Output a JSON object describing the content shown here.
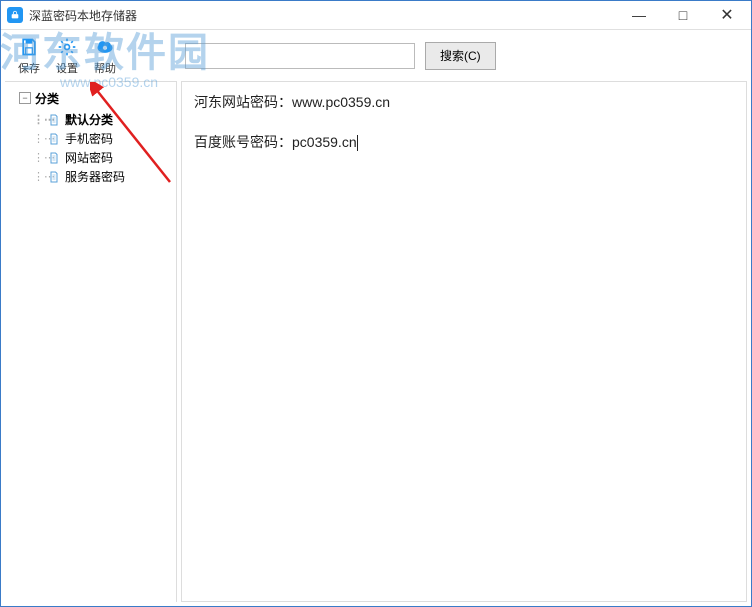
{
  "title": "深蓝密码本地存储器",
  "window": {
    "min": "—",
    "max": "□",
    "close": "✕"
  },
  "toolbar": {
    "save": "保存",
    "settings": "设置",
    "help": "帮助"
  },
  "search": {
    "placeholder": "",
    "button": "搜索(C)"
  },
  "tree": {
    "root": "分类",
    "items": [
      {
        "label": "默认分类"
      },
      {
        "label": "手机密码"
      },
      {
        "label": "网站密码"
      },
      {
        "label": "服务器密码"
      }
    ]
  },
  "content": {
    "line1": "河东网站密码：www.pc0359.cn",
    "line2": "百度账号密码：pc0359.cn"
  },
  "watermark": {
    "text": "河东软件园",
    "url": "www.pc0359.cn"
  }
}
